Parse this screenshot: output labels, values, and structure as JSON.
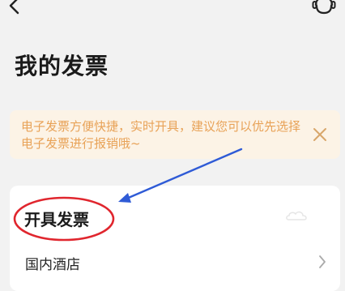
{
  "header": {
    "back_icon": "chevron-left-icon",
    "service_icon": "headset-icon"
  },
  "page": {
    "title": "我的发票"
  },
  "notice": {
    "text": "电子发票方便快捷，实时开具，建议您可以优先选择电子发票进行报销哦~",
    "close_icon": "close-icon"
  },
  "invoice_section": {
    "title": "开具发票",
    "items": [
      {
        "label": "国内酒店",
        "icon": "chevron-right-icon"
      }
    ]
  },
  "annotation": {
    "color": "#e0262e",
    "arrow_color": "#2f5bd6"
  },
  "colors": {
    "background": "#f2f2f2",
    "notice_bg": "#fcf3e6",
    "notice_text": "#e8a257",
    "card_bg": "#ffffff"
  }
}
